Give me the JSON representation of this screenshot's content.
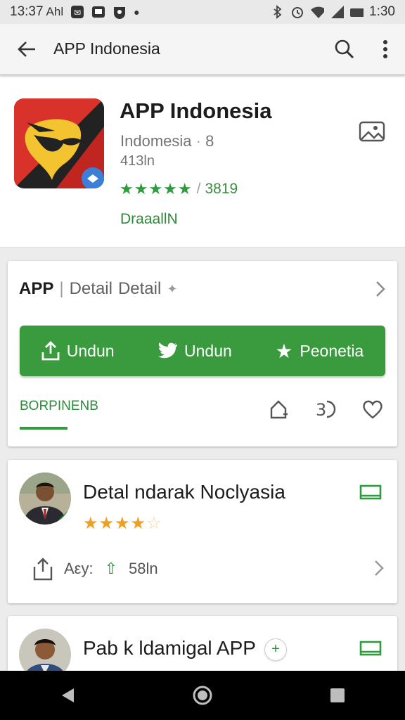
{
  "status_bar": {
    "time": "13:37",
    "carrier": "Ahl",
    "clock_right": "1:30"
  },
  "app_bar": {
    "title": "APP Indonesia"
  },
  "header": {
    "title": "APP Indonesia",
    "developer": "Indomesia",
    "developer_suffix": "8",
    "size": "413ln",
    "rating_stars": "★★★★★",
    "rating_count": "3819",
    "install_label": "DraaallN"
  },
  "detail_card": {
    "app_label": "APP",
    "separator": "|",
    "detail1": "Detail",
    "detail2": "Detail",
    "buttons": [
      "Undun",
      "Undun",
      "Peonetia"
    ],
    "tab_label": "BORPINENB"
  },
  "reviews": [
    {
      "title": "Detal ndarak Noclyasia",
      "rating": 3.5,
      "footer_label": "Aεy:",
      "footer_value": "58ln"
    },
    {
      "title": "Pab k ldamigal APP"
    }
  ],
  "colors": {
    "accent_green": "#3a9a3e",
    "star_orange": "#f0a020"
  }
}
